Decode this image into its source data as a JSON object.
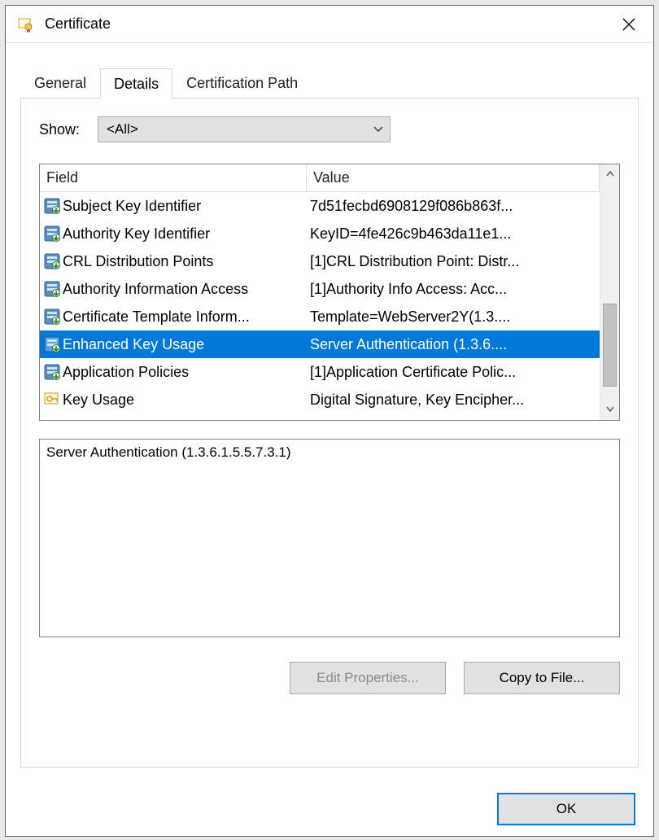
{
  "window": {
    "title": "Certificate"
  },
  "tabs": [
    {
      "label": "General",
      "active": false
    },
    {
      "label": "Details",
      "active": true
    },
    {
      "label": "Certification Path",
      "active": false
    }
  ],
  "show": {
    "label": "Show:",
    "value": "<All>"
  },
  "columns": {
    "field": "Field",
    "value": "Value"
  },
  "rows": [
    {
      "field": "Subject Key Identifier",
      "value": "7d51fecbd6908129f086b863f...",
      "icon": "ext",
      "selected": false
    },
    {
      "field": "Authority Key Identifier",
      "value": "KeyID=4fe426c9b463da11e1...",
      "icon": "ext",
      "selected": false
    },
    {
      "field": "CRL Distribution Points",
      "value": "[1]CRL Distribution Point: Distr...",
      "icon": "ext",
      "selected": false
    },
    {
      "field": "Authority Information Access",
      "value": "[1]Authority Info Access: Acc...",
      "icon": "ext",
      "selected": false
    },
    {
      "field": "Certificate Template Inform...",
      "value": "Template=WebServer2Y(1.3....",
      "icon": "ext",
      "selected": false
    },
    {
      "field": "Enhanced Key Usage",
      "value": "Server Authentication (1.3.6....",
      "icon": "ext",
      "selected": true
    },
    {
      "field": "Application Policies",
      "value": "[1]Application Certificate Polic...",
      "icon": "ext",
      "selected": false
    },
    {
      "field": "Key Usage",
      "value": "Digital Signature, Key Encipher...",
      "icon": "key",
      "selected": false
    }
  ],
  "detail": "Server Authentication (1.3.6.1.5.5.7.3.1)",
  "buttons": {
    "edit": "Edit Properties...",
    "copy": "Copy to File...",
    "ok": "OK"
  }
}
